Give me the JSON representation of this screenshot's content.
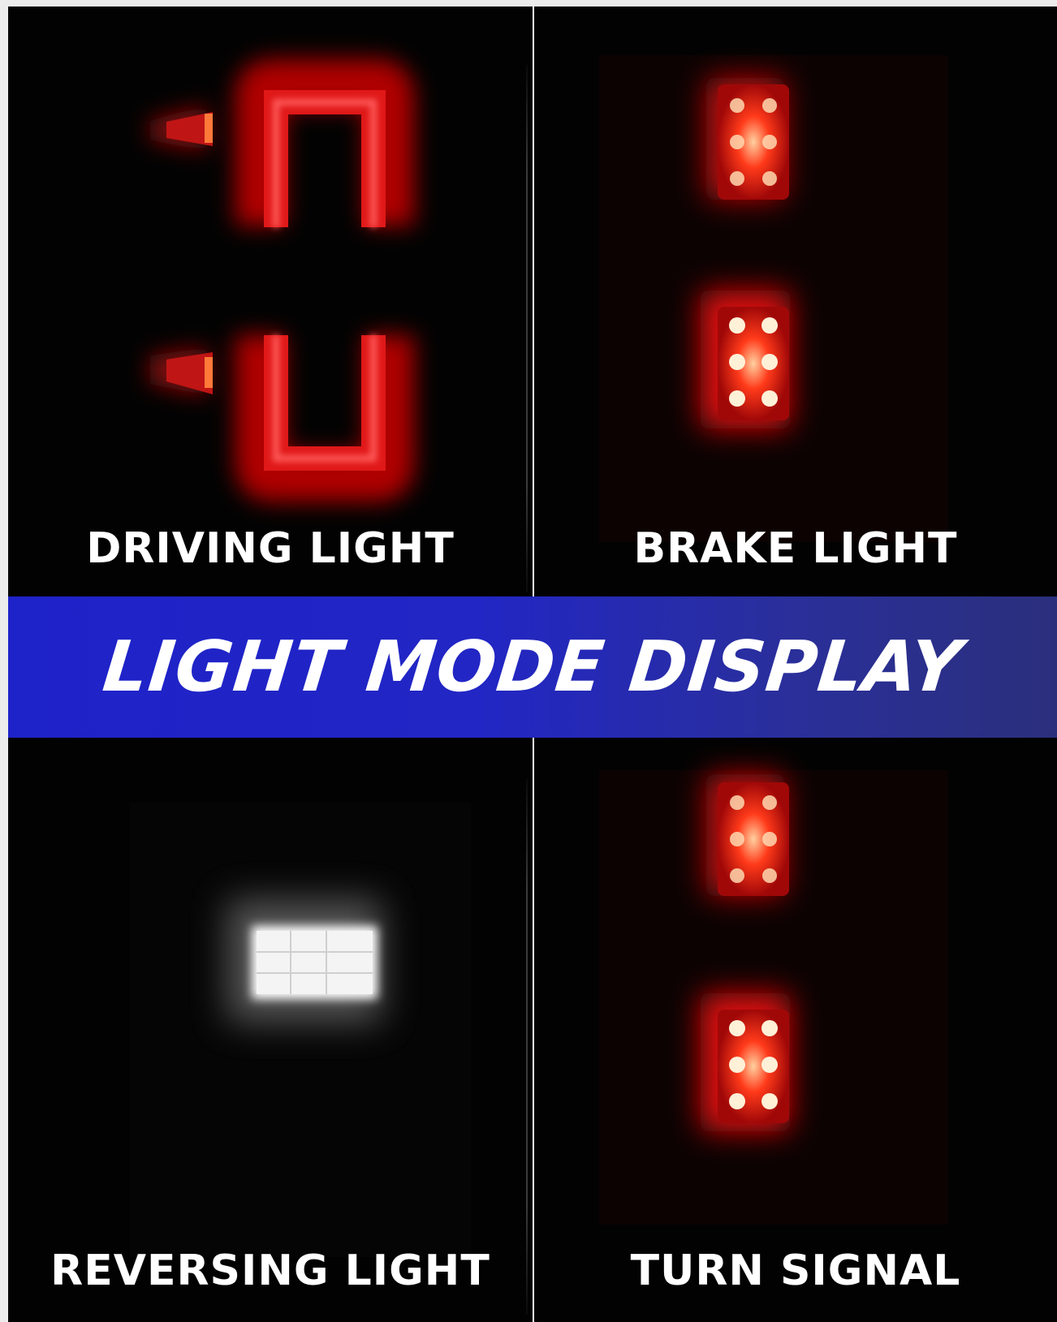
{
  "banner": {
    "title": "LIGHT MODE DISPLAY",
    "color": "#2226c4"
  },
  "modes": [
    {
      "label": "DRIVING LIGHT"
    },
    {
      "label": "BRAKE LIGHT"
    },
    {
      "label": "REVERSING LIGHT"
    },
    {
      "label": "TURN SIGNAL"
    }
  ],
  "colors": {
    "background": "#020202",
    "red_glow": "#ff2a2a",
    "white_glow": "#ffffff"
  }
}
